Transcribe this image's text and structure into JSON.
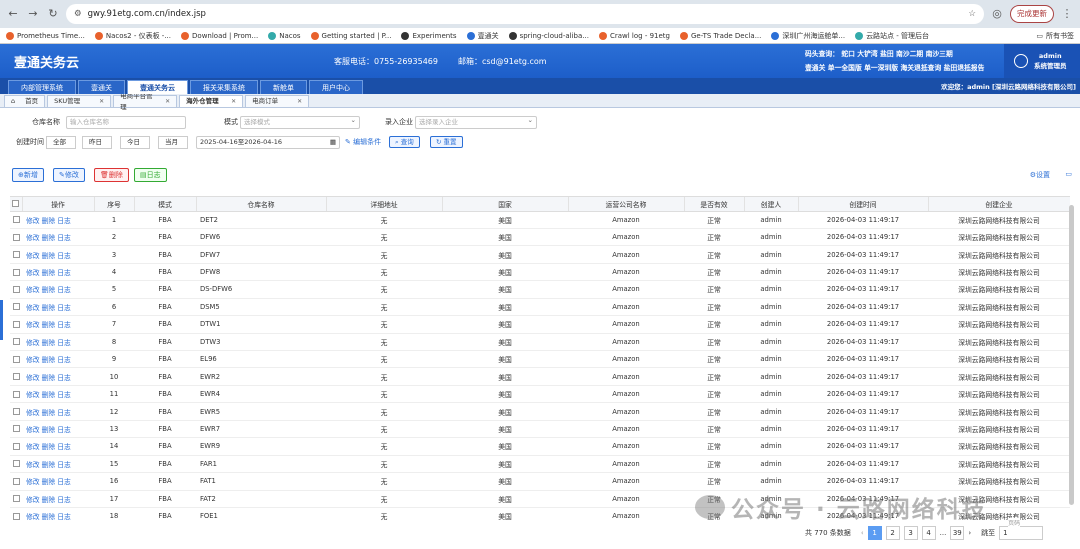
{
  "browser": {
    "url": "gwy.91etg.com.cn/index.jsp",
    "update_label": "完成更新",
    "bookmarks": [
      "Prometheus Time...",
      "Nacos2 - 仪表板 -...",
      "Download | Prom...",
      "Nacos",
      "Getting started | P...",
      "Experiments",
      "壹通关",
      "spring-cloud-aliba...",
      "Crawl log - 91etg",
      "Ge-TS Trade Decla...",
      "深圳广州海运舱单...",
      "云路站点 - 管理后台"
    ],
    "all_bookmarks": "所有书签"
  },
  "header": {
    "brand": "壹通关务云",
    "phone": "客服电话：0755-26935469",
    "email": "邮箱：csd@91etg.com",
    "ports_line1": "码头查询： 蛇口  大铲湾  盐田  南沙二期  南沙三期",
    "ports_line2": "壹通关  单一全国版  单一深圳版  海关退抵查询  盐田退抵报告",
    "user_name": "admin",
    "user_role": "系统管理员"
  },
  "menu": {
    "tabs": [
      "内部管理系统",
      "壹通关",
      "壹通关务云",
      "报关采集系统",
      "新舱单",
      "用户中心"
    ],
    "welcome": "欢迎您：admin [深圳云路网络科技有限公司]"
  },
  "page_tabs": [
    "首页",
    "SKU管理",
    "电商平台管理",
    "海外仓管理",
    "电商订单"
  ],
  "filters": {
    "warehouse_label": "仓库名称",
    "warehouse_placeholder": "输入仓库名称",
    "mode_label": "模式",
    "mode_placeholder": "选择模式",
    "company_label": "录入企业",
    "company_placeholder": "选择录入企业",
    "created_label": "创建时间",
    "quick": [
      "全部",
      "昨日",
      "今日",
      "当月"
    ],
    "date_range": "2025-04-16至2026-04-16",
    "edit_cond": "编辑条件",
    "query": "查询",
    "reset": "重置"
  },
  "toolbar": {
    "add": "新增",
    "edit": "修改",
    "delete": "删除",
    "log": "日志",
    "settings": "设置"
  },
  "table": {
    "columns": [
      "操作",
      "序号",
      "模式",
      "仓库名称",
      "详细地址",
      "国家",
      "运营公司名称",
      "是否有效",
      "创建人",
      "创建时间",
      "创建企业"
    ],
    "op_links": [
      "修改",
      "删除",
      "日志"
    ],
    "rows": [
      [
        "1",
        "FBA",
        "DET2",
        "无",
        "美国",
        "Amazon",
        "正常",
        "admin",
        "2026-04-03 11:49:17",
        "深圳云路网络科技有限公司"
      ],
      [
        "2",
        "FBA",
        "DFW6",
        "无",
        "美国",
        "Amazon",
        "正常",
        "admin",
        "2026-04-03 11:49:17",
        "深圳云路网络科技有限公司"
      ],
      [
        "3",
        "FBA",
        "DFW7",
        "无",
        "美国",
        "Amazon",
        "正常",
        "admin",
        "2026-04-03 11:49:17",
        "深圳云路网络科技有限公司"
      ],
      [
        "4",
        "FBA",
        "DFW8",
        "无",
        "美国",
        "Amazon",
        "正常",
        "admin",
        "2026-04-03 11:49:17",
        "深圳云路网络科技有限公司"
      ],
      [
        "5",
        "FBA",
        "DS-DFW6",
        "无",
        "美国",
        "Amazon",
        "正常",
        "admin",
        "2026-04-03 11:49:17",
        "深圳云路网络科技有限公司"
      ],
      [
        "6",
        "FBA",
        "DSM5",
        "无",
        "美国",
        "Amazon",
        "正常",
        "admin",
        "2026-04-03 11:49:17",
        "深圳云路网络科技有限公司"
      ],
      [
        "7",
        "FBA",
        "DTW1",
        "无",
        "美国",
        "Amazon",
        "正常",
        "admin",
        "2026-04-03 11:49:17",
        "深圳云路网络科技有限公司"
      ],
      [
        "8",
        "FBA",
        "DTW3",
        "无",
        "美国",
        "Amazon",
        "正常",
        "admin",
        "2026-04-03 11:49:17",
        "深圳云路网络科技有限公司"
      ],
      [
        "9",
        "FBA",
        "EL96",
        "无",
        "美国",
        "Amazon",
        "正常",
        "admin",
        "2026-04-03 11:49:17",
        "深圳云路网络科技有限公司"
      ],
      [
        "10",
        "FBA",
        "EWR2",
        "无",
        "美国",
        "Amazon",
        "正常",
        "admin",
        "2026-04-03 11:49:17",
        "深圳云路网络科技有限公司"
      ],
      [
        "11",
        "FBA",
        "EWR4",
        "无",
        "美国",
        "Amazon",
        "正常",
        "admin",
        "2026-04-03 11:49:17",
        "深圳云路网络科技有限公司"
      ],
      [
        "12",
        "FBA",
        "EWR5",
        "无",
        "美国",
        "Amazon",
        "正常",
        "admin",
        "2026-04-03 11:49:17",
        "深圳云路网络科技有限公司"
      ],
      [
        "13",
        "FBA",
        "EWR7",
        "无",
        "美国",
        "Amazon",
        "正常",
        "admin",
        "2026-04-03 11:49:17",
        "深圳云路网络科技有限公司"
      ],
      [
        "14",
        "FBA",
        "EWR9",
        "无",
        "美国",
        "Amazon",
        "正常",
        "admin",
        "2026-04-03 11:49:17",
        "深圳云路网络科技有限公司"
      ],
      [
        "15",
        "FBA",
        "FAR1",
        "无",
        "美国",
        "Amazon",
        "正常",
        "admin",
        "2026-04-03 11:49:17",
        "深圳云路网络科技有限公司"
      ],
      [
        "16",
        "FBA",
        "FAT1",
        "无",
        "美国",
        "Amazon",
        "正常",
        "admin",
        "2026-04-03 11:49:17",
        "深圳云路网络科技有限公司"
      ],
      [
        "17",
        "FBA",
        "FAT2",
        "无",
        "美国",
        "Amazon",
        "正常",
        "admin",
        "2026-04-03 11:49:17",
        "深圳云路网络科技有限公司"
      ],
      [
        "18",
        "FBA",
        "FOE1",
        "无",
        "美国",
        "Amazon",
        "正常",
        "admin",
        "2026-04-03 11:49:17",
        "深圳云路网络科技有限公司"
      ]
    ]
  },
  "pager": {
    "total": "共 770 条数据",
    "pages": [
      "1",
      "2",
      "3",
      "4",
      "...",
      "39"
    ],
    "goto_label": "跳至",
    "goto_value": "1",
    "page_suffix": "页码"
  },
  "watermark": "公众号 · 云路网络科技"
}
